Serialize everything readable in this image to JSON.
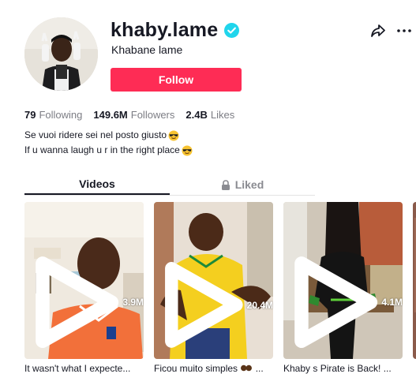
{
  "profile": {
    "username": "khaby.lame",
    "nickname": "Khabane lame",
    "follow_label": "Follow"
  },
  "stats": [
    {
      "value": "79",
      "label": "Following"
    },
    {
      "value": "149.6M",
      "label": "Followers"
    },
    {
      "value": "2.4B",
      "label": "Likes"
    }
  ],
  "bio": [
    "Se vuoi ridere sei nel posto giusto",
    "If u wanna laugh u r in the right place"
  ],
  "tabs": {
    "videos": "Videos",
    "liked": "Liked"
  },
  "videos": [
    {
      "views": "3.9M",
      "caption": "It wasn't what I expecte..."
    },
    {
      "views": "20.4M",
      "caption": "Ficou muito simples"
    },
    {
      "views": "4.1M",
      "caption": "Khaby s Pirate is Back! ..."
    }
  ],
  "colors": {
    "follow": "#fe2c55",
    "verified": "#20d5ec",
    "text": "#161823",
    "muted": "#7c7d84"
  }
}
